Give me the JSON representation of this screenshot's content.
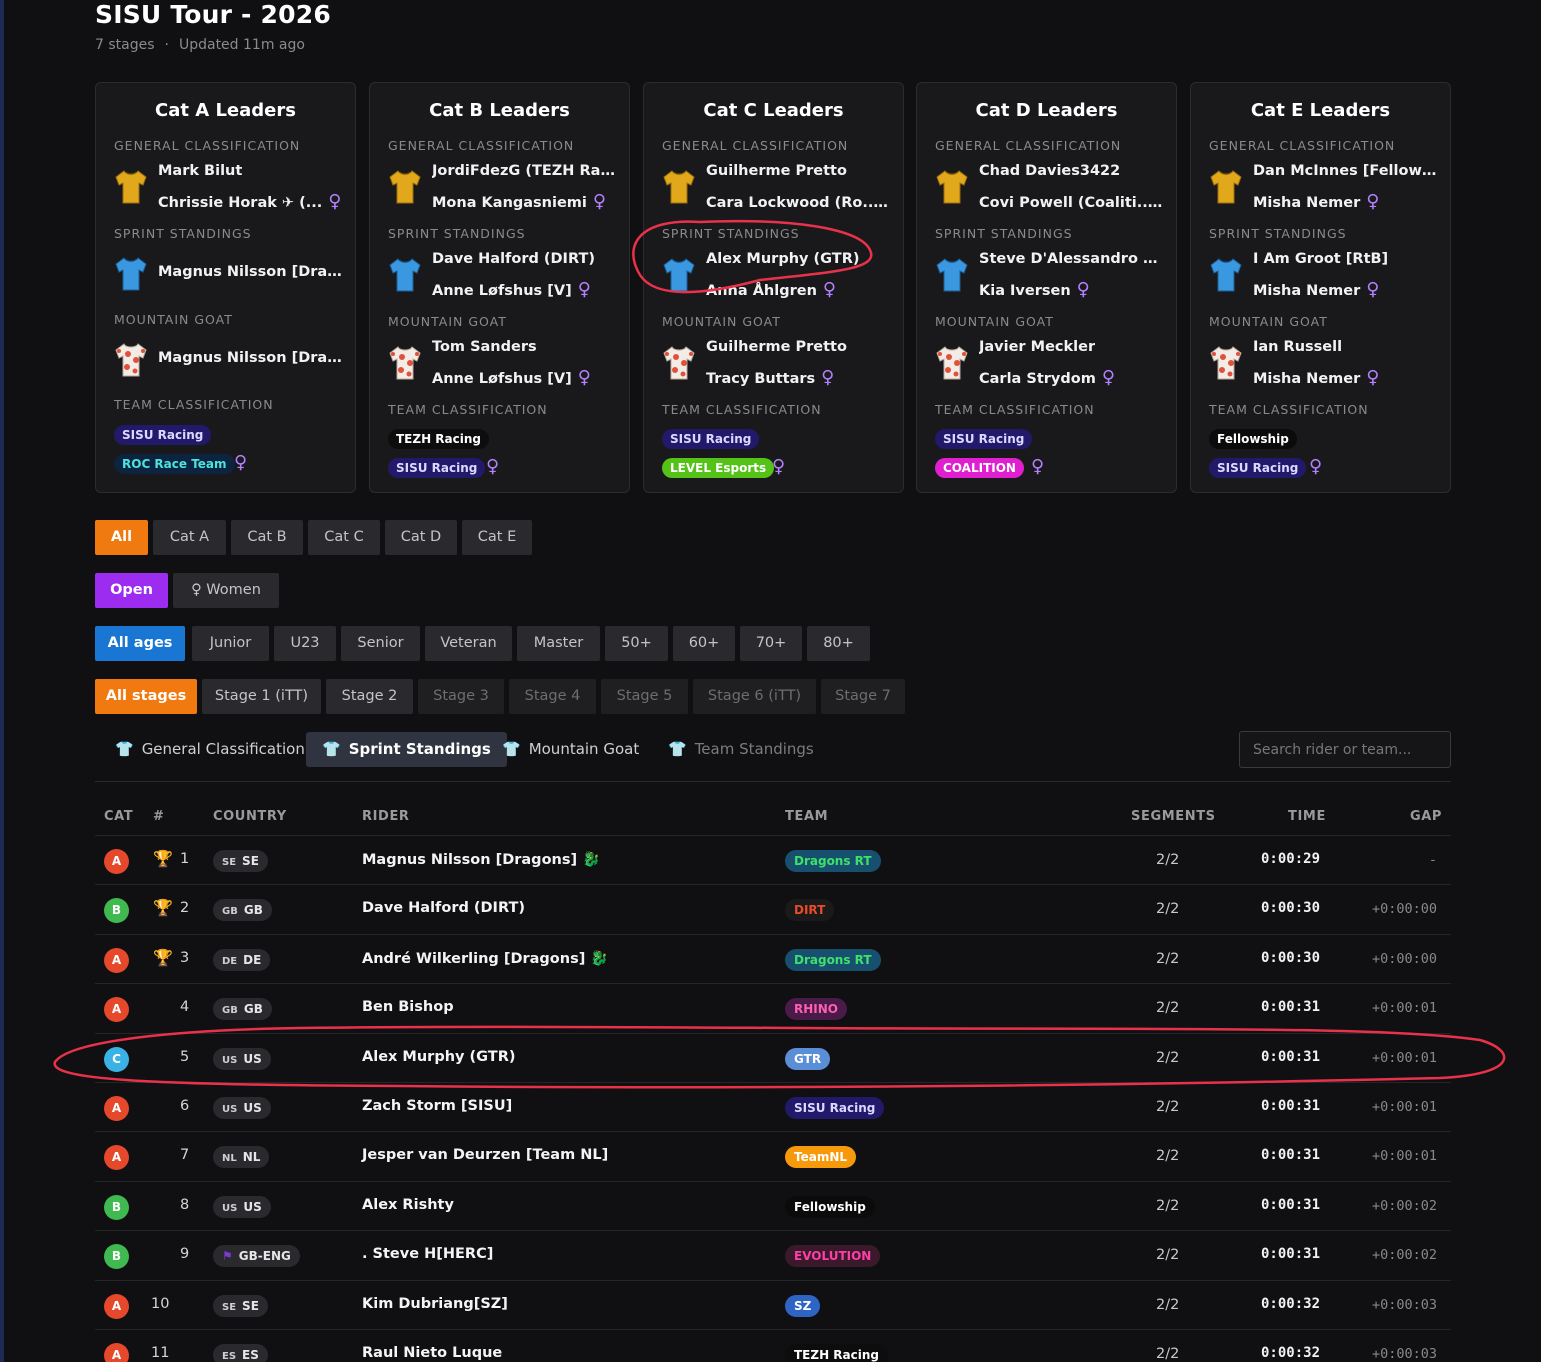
{
  "header": {
    "title": "SISU Tour - 2026",
    "stages": "7 stages",
    "separator": "·",
    "updated": "Updated 11m ago"
  },
  "cards": [
    {
      "title": "Cat A Leaders",
      "gc_label": "GENERAL CLASSIFICATION",
      "gc1": "Mark Bilut",
      "gc2": "Chrissie Horak ✈ (...",
      "sprint_label": "SPRINT STANDINGS",
      "sprint1": "Magnus Nilsson [Drago...",
      "sprint2": "",
      "mountain_label": "MOUNTAIN GOAT",
      "mountain1": "Magnus Nilsson [Drago...",
      "mountain2": "",
      "team_label": "TEAM CLASSIFICATION",
      "team1": "SISU Racing",
      "team2": "ROC Race Team"
    },
    {
      "title": "Cat B Leaders",
      "gc_label": "GENERAL CLASSIFICATION",
      "gc1": "JordiFdezG (TEZH Racin...",
      "gc2": "Mona Kangasniemi",
      "sprint_label": "SPRINT STANDINGS",
      "sprint1": "Dave Halford (DIRT)",
      "sprint2": "Anne Løfshus [V]",
      "mountain_label": "MOUNTAIN GOAT",
      "mountain1": "Tom Sanders",
      "mountain2": "Anne Løfshus [V]",
      "team_label": "TEAM CLASSIFICATION",
      "team1": "TEZH Racing",
      "team2": "SISU Racing"
    },
    {
      "title": "Cat C Leaders",
      "gc_label": "GENERAL CLASSIFICATION",
      "gc1": "Guilherme Pretto",
      "gc2": "Cara Lockwood (Ro...",
      "sprint_label": "SPRINT STANDINGS",
      "sprint1": "Alex Murphy (GTR)",
      "sprint2": "Anna Åhlgren",
      "mountain_label": "MOUNTAIN GOAT",
      "mountain1": "Guilherme Pretto",
      "mountain2": "Tracy Buttars",
      "team_label": "TEAM CLASSIFICATION",
      "team1": "SISU Racing",
      "team2": "LEVEL Esports"
    },
    {
      "title": "Cat D Leaders",
      "gc_label": "GENERAL CLASSIFICATION",
      "gc1": "Chad Davies3422",
      "gc2": "Covi Powell (Coaliti...",
      "sprint_label": "SPRINT STANDINGS",
      "sprint1": "Steve D'Alessandro (Co...",
      "sprint2": "Kia Iversen",
      "mountain_label": "MOUNTAIN GOAT",
      "mountain1": "Javier Meckler",
      "mountain2": "Carla Strydom",
      "team_label": "TEAM CLASSIFICATION",
      "team1": "SISU Racing",
      "team2": "COALITION"
    },
    {
      "title": "Cat E Leaders",
      "gc_label": "GENERAL CLASSIFICATION",
      "gc1": "Dan McInnes [Fellowship]",
      "gc2": "Misha Nemer",
      "sprint_label": "SPRINT STANDINGS",
      "sprint1": "I Am Groot [RtB]",
      "sprint2": "Misha Nemer",
      "mountain_label": "MOUNTAIN GOAT",
      "mountain1": "Ian Russell",
      "mountain2": "Misha Nemer",
      "team_label": "TEAM CLASSIFICATION",
      "team1": "Fellowship",
      "team2": "SISU Racing"
    }
  ],
  "filters": {
    "categories": [
      "All",
      "Cat A",
      "Cat B",
      "Cat C",
      "Cat D",
      "Cat E"
    ],
    "genders": [
      "Open",
      "♀ Women"
    ],
    "ages": [
      "All ages",
      "Junior",
      "U23",
      "Senior",
      "Veteran",
      "Master",
      "50+",
      "60+",
      "70+",
      "80+"
    ],
    "stages": [
      "All stages",
      "Stage 1 (iTT)",
      "Stage 2",
      "Stage 3",
      "Stage 4",
      "Stage 5",
      "Stage 6 (iTT)",
      "Stage 7"
    ]
  },
  "tabs": [
    "General Classification",
    "Sprint Standings",
    "Mountain Goat",
    "Team Standings"
  ],
  "search": {
    "placeholder": "Search rider or team..."
  },
  "table": {
    "headers": [
      "CAT",
      "#",
      "COUNTRY",
      "RIDER",
      "TEAM",
      "SEGMENTS",
      "TIME",
      "GAP"
    ],
    "rows": [
      {
        "cat": "A",
        "pos": "1",
        "cc": "SE",
        "country": "SE",
        "rider": "Magnus Nilsson [Dragons]",
        "team": "Dragons RT",
        "segments": "2/2",
        "time": "0:00:29",
        "gap": "-"
      },
      {
        "cat": "B",
        "pos": "2",
        "cc": "GB",
        "country": "GB",
        "rider": "Dave Halford (DIRT)",
        "team": "DIRT",
        "segments": "2/2",
        "time": "0:00:30",
        "gap": "+0:00:00"
      },
      {
        "cat": "A",
        "pos": "3",
        "cc": "DE",
        "country": "DE",
        "rider": "André Wilkerling [Dragons]",
        "team": "Dragons RT",
        "segments": "2/2",
        "time": "0:00:30",
        "gap": "+0:00:00"
      },
      {
        "cat": "A",
        "pos": "4",
        "cc": "GB",
        "country": "GB",
        "rider": "Ben Bishop",
        "team": "RHINO",
        "segments": "2/2",
        "time": "0:00:31",
        "gap": "+0:00:01"
      },
      {
        "cat": "C",
        "pos": "5",
        "cc": "US",
        "country": "US",
        "rider": "Alex Murphy (GTR)",
        "team": "GTR",
        "segments": "2/2",
        "time": "0:00:31",
        "gap": "+0:00:01"
      },
      {
        "cat": "A",
        "pos": "6",
        "cc": "US",
        "country": "US",
        "rider": "Zach Storm [SISU]",
        "team": "SISU Racing",
        "segments": "2/2",
        "time": "0:00:31",
        "gap": "+0:00:01"
      },
      {
        "cat": "A",
        "pos": "7",
        "cc": "NL",
        "country": "NL",
        "rider": "Jesper van Deurzen [Team NL]",
        "team": "TeamNL",
        "segments": "2/2",
        "time": "0:00:31",
        "gap": "+0:00:01"
      },
      {
        "cat": "B",
        "pos": "8",
        "cc": "US",
        "country": "US",
        "rider": "Alex Rishty",
        "team": "Fellowship",
        "segments": "2/2",
        "time": "0:00:31",
        "gap": "+0:00:02"
      },
      {
        "cat": "B",
        "pos": "9",
        "cc": "⚑",
        "country": "GB-ENG",
        "rider": ". Steve H[HERC]",
        "team": "EVOLUTION",
        "segments": "2/2",
        "time": "0:00:31",
        "gap": "+0:00:02"
      },
      {
        "cat": "A",
        "pos": "10",
        "cc": "SE",
        "country": "SE",
        "rider": "Kim Dubriang[SZ]",
        "team": "SZ",
        "segments": "2/2",
        "time": "0:00:32",
        "gap": "+0:00:03"
      },
      {
        "cat": "A",
        "pos": "11",
        "cc": "ES",
        "country": "ES",
        "rider": "Raul Nieto Luque",
        "team": "TEZH Racing",
        "segments": "2/2",
        "time": "0:00:32",
        "gap": "+0:00:03"
      }
    ]
  },
  "colors": {
    "accent_orange": "#f07a10",
    "accent_purple": "#9b2cf0",
    "accent_blue": "#1976d2",
    "cat_A": "#e5482b",
    "cat_B": "#3fb950",
    "cat_C": "#3ab2e6",
    "annotation": "#e8324a"
  }
}
